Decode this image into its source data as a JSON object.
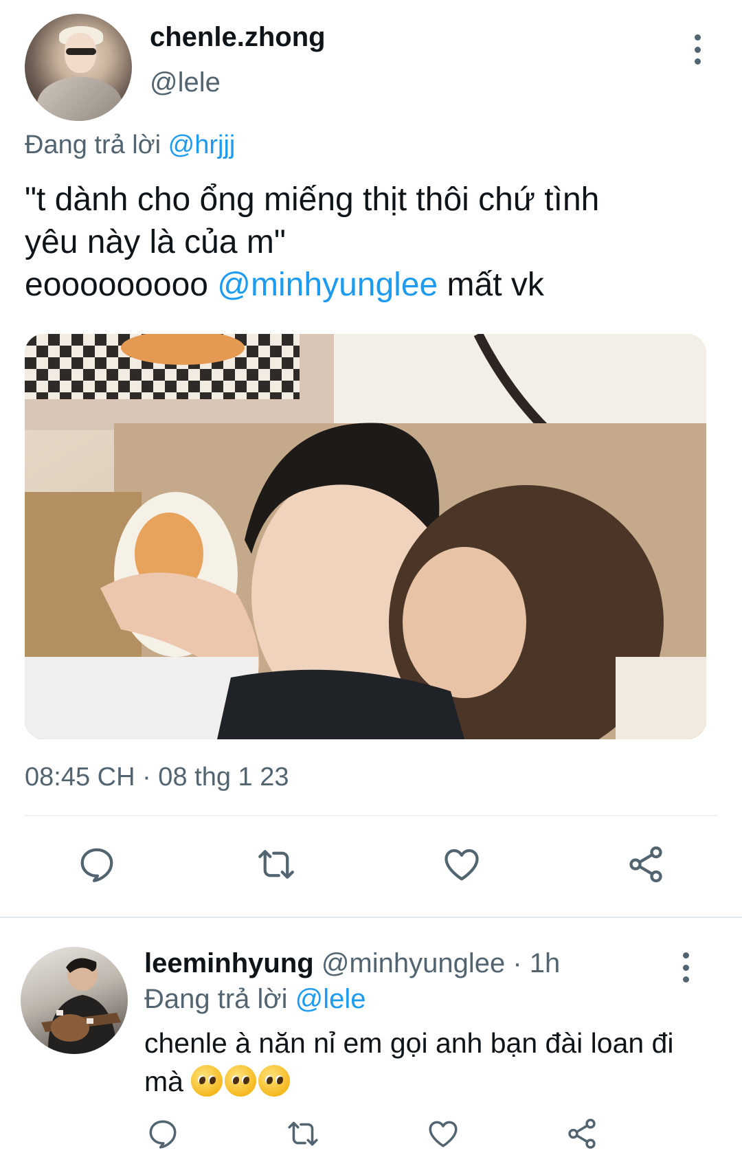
{
  "tweet": {
    "display_name": "chenle.zhong",
    "handle": "@lele",
    "replying_prefix": "Đang trả lời",
    "replying_to": "@hrjjj",
    "text_line1": "\"t dành cho ổng miếng thịt thôi chứ tình",
    "text_line2": "yêu này là của m\"",
    "text_line3_prefix": "eooooooooo",
    "text_line3_mention": "@minhyunglee",
    "text_line3_suffix": "mất vk",
    "timestamp": "08:45 CH · 08 thg 1 23",
    "actions": [
      "reply-icon",
      "retweet-icon",
      "like-icon",
      "share-icon"
    ],
    "colors": {
      "text": "#0f1419",
      "muted": "#536471",
      "mention": "#1d9bf0"
    }
  },
  "reply": {
    "display_name": "leeminhyung",
    "handle": "@minhyunglee",
    "time": "· 1h",
    "replying_prefix": "Đang trả lời",
    "replying_to": "@lele",
    "text": "chenle à năn nỉ em gọi anh bạn đài loan đi mà",
    "emoji_count": 3,
    "actions": [
      "reply-icon",
      "retweet-icon",
      "like-icon",
      "share-icon"
    ]
  }
}
